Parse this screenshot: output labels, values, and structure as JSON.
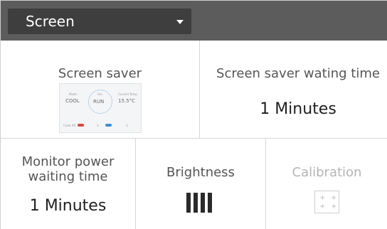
{
  "header": {
    "dropdown_label": "Screen"
  },
  "tiles": {
    "screen_saver": {
      "title": "Screen saver",
      "preview": {
        "mode_label": "Mode",
        "mode_value": "COOL",
        "fan_label": "Fan",
        "fan_value": "RUN",
        "temp_label": "Current Temp",
        "temp_value": "15.5°C",
        "code_label": "Code #0",
        "indicator_a": "3",
        "indicator_b": "3"
      }
    },
    "screen_saver_waiting_time": {
      "title": "Screen saver wating time",
      "value": "1 Minutes"
    },
    "monitor_power_waiting_time": {
      "title_line1": "Monitor power",
      "title_line2": "waiting time",
      "value": "1 Minutes"
    },
    "brightness": {
      "title": "Brightness",
      "level_bars": 4
    },
    "calibration": {
      "title": "Calibration",
      "enabled": false
    }
  },
  "colors": {
    "topbar": "#5c5c5c",
    "dropdown": "#3e3e3e",
    "red_indicator": "#e0473e",
    "blue_indicator": "#3a8fd6"
  }
}
